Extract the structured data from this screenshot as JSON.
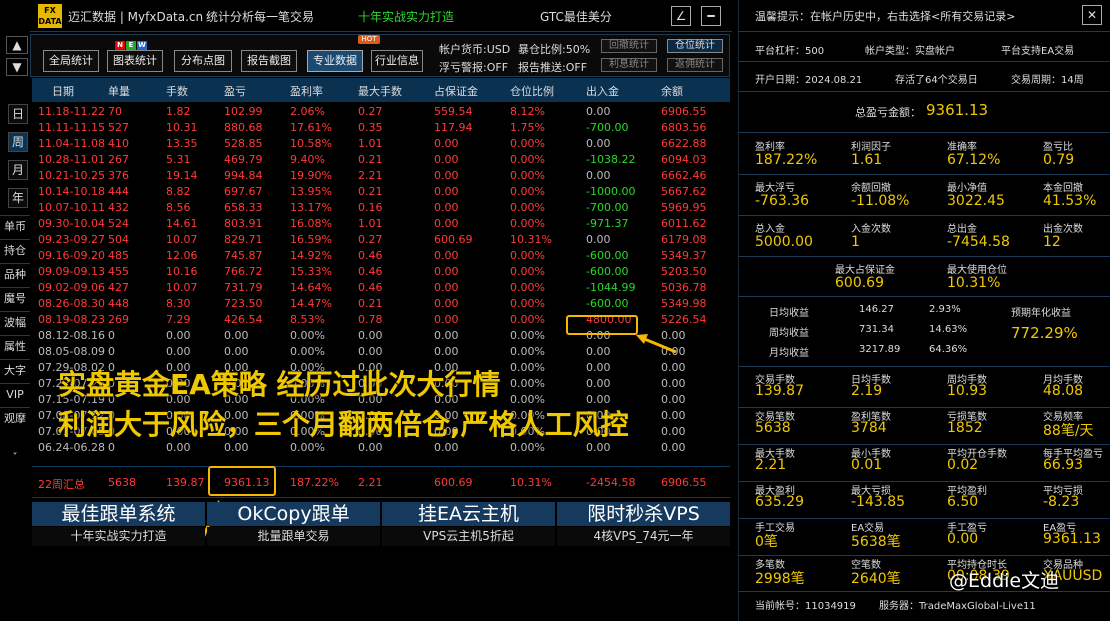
{
  "app": {
    "logo_text_top": "FX",
    "logo_text_bottom": "DATA",
    "title": "迈汇数据 | MyfxData.cn",
    "slogan": "统计分析每一笔交易",
    "tagline": "十年实战实力打造",
    "account_name": "GTC最佳美分"
  },
  "sidebar": {
    "up": "▲",
    "down": "▼",
    "periods": [
      "日",
      "周",
      "月",
      "年"
    ],
    "active_period": "周",
    "items": [
      "单币",
      "持仓",
      "品种",
      "魔号",
      "波幅",
      "属性",
      "大字",
      "VIP",
      "观摩"
    ],
    "collapse": "˅"
  },
  "toolbar": {
    "buttons": [
      "全局统计",
      "图表统计",
      "分布点图",
      "报告截图",
      "专业数据",
      "行业信息"
    ],
    "active_button": "专业数据",
    "hot_badge": "HOT",
    "new_badge": [
      "N",
      "E",
      "W"
    ],
    "currency": "帐户货币:USD",
    "blowup": "暴仓比例:50%",
    "float_alert": "浮亏警报:OFF",
    "report_push": "报告推送:OFF",
    "mini_buttons": [
      "回撤统计",
      "仓位统计",
      "利息统计",
      "返佣统计"
    ],
    "mini_active": "仓位统计"
  },
  "table": {
    "headers": [
      "日期",
      "单量",
      "手数",
      "盈亏",
      "盈利率",
      "最大手数",
      "占保证金",
      "仓位比例",
      "出入金",
      "余额"
    ],
    "rows": [
      [
        "11.18-11.22",
        "70",
        "1.82",
        "102.99",
        "2.06%",
        "0.27",
        "559.54",
        "8.12%",
        "0.00",
        "6906.55"
      ],
      [
        "11.11-11.15",
        "527",
        "10.31",
        "880.68",
        "17.61%",
        "0.35",
        "117.94",
        "1.75%",
        "-700.00",
        "6803.56"
      ],
      [
        "11.04-11.08",
        "410",
        "13.35",
        "528.85",
        "10.58%",
        "1.01",
        "0.00",
        "0.00%",
        "0.00",
        "6622.88"
      ],
      [
        "10.28-11.01",
        "267",
        "5.31",
        "469.79",
        "9.40%",
        "0.21",
        "0.00",
        "0.00%",
        "-1038.22",
        "6094.03"
      ],
      [
        "10.21-10.25",
        "376",
        "19.14",
        "994.84",
        "19.90%",
        "2.21",
        "0.00",
        "0.00%",
        "0.00",
        "6662.46"
      ],
      [
        "10.14-10.18",
        "444",
        "8.82",
        "697.67",
        "13.95%",
        "0.21",
        "0.00",
        "0.00%",
        "-1000.00",
        "5667.62"
      ],
      [
        "10.07-10.11",
        "432",
        "8.56",
        "658.33",
        "13.17%",
        "0.16",
        "0.00",
        "0.00%",
        "-700.00",
        "5969.95"
      ],
      [
        "09.30-10.04",
        "524",
        "14.61",
        "803.91",
        "16.08%",
        "1.01",
        "0.00",
        "0.00%",
        "-971.37",
        "6011.62"
      ],
      [
        "09.23-09.27",
        "504",
        "10.07",
        "829.71",
        "16.59%",
        "0.27",
        "600.69",
        "10.31%",
        "0.00",
        "6179.08"
      ],
      [
        "09.16-09.20",
        "485",
        "12.06",
        "745.87",
        "14.92%",
        "0.46",
        "0.00",
        "0.00%",
        "-600.00",
        "5349.37"
      ],
      [
        "09.09-09.13",
        "455",
        "10.16",
        "766.72",
        "15.33%",
        "0.46",
        "0.00",
        "0.00%",
        "-600.00",
        "5203.50"
      ],
      [
        "09.02-09.06",
        "427",
        "10.07",
        "731.79",
        "14.64%",
        "0.46",
        "0.00",
        "0.00%",
        "-1044.99",
        "5036.78"
      ],
      [
        "08.26-08.30",
        "448",
        "8.30",
        "723.50",
        "14.47%",
        "0.21",
        "0.00",
        "0.00%",
        "-600.00",
        "5349.98"
      ],
      [
        "08.19-08.23",
        "269",
        "7.29",
        "426.54",
        "8.53%",
        "0.78",
        "0.00",
        "0.00%",
        "4800.00",
        "5226.54"
      ],
      [
        "08.12-08.16",
        "0",
        "0.00",
        "0.00",
        "0.00%",
        "0.00",
        "0.00",
        "0.00%",
        "0.00",
        "0.00"
      ],
      [
        "08.05-08.09",
        "0",
        "0.00",
        "0.00",
        "0.00%",
        "0.00",
        "0.00",
        "0.00%",
        "0.00",
        "0.00"
      ],
      [
        "07.29-08.02",
        "0",
        "0.00",
        "0.00",
        "0.00%",
        "0.00",
        "0.00",
        "0.00%",
        "0.00",
        "0.00"
      ],
      [
        "07.22-07.26",
        "0",
        "0.00",
        "0.00",
        "0.00%",
        "0.00",
        "0.00",
        "0.00%",
        "0.00",
        "0.00"
      ],
      [
        "07.15-07.19",
        "0",
        "0.00",
        "0.00",
        "0.00%",
        "0.00",
        "0.00",
        "0.00%",
        "0.00",
        "0.00"
      ],
      [
        "07.08-07.12",
        "0",
        "0.00",
        "0.00",
        "0.00%",
        "0.00",
        "0.00",
        "0.00%",
        "0.00",
        "0.00"
      ],
      [
        "07.01-07.05",
        "0",
        "0.00",
        "0.00",
        "0.00%",
        "0.00",
        "0.00",
        "0.00%",
        "0.00",
        "0.00"
      ],
      [
        "06.24-06.28",
        "0",
        "0.00",
        "0.00",
        "0.00%",
        "0.00",
        "0.00",
        "0.00%",
        "0.00",
        "0.00"
      ]
    ],
    "summary": [
      "22周汇总",
      "5638",
      "139.87",
      "9361.13",
      "187.22%",
      "2.21",
      "600.69",
      "10.31%",
      "-2454.58",
      "6906.55"
    ]
  },
  "overlay_text": {
    "line1": "实盘黄金EA策略 经历过此次大行情",
    "line2": "利润大于风险，三个月翻两倍仓,严格人工风控"
  },
  "banners": [
    {
      "title": "最佳跟单系统",
      "sub": "十年实战实力打造"
    },
    {
      "title": "OkCopy跟单",
      "sub": "批量跟单交易"
    },
    {
      "title": "挂EA云主机",
      "sub": "VPS云主机5折起"
    },
    {
      "title": "限时秒杀VPS",
      "sub": "4核VPS_74元一年"
    }
  ],
  "right_panel": {
    "notice": "温馨提示：在帐户历史中，右击选择<所有交易记录>",
    "close": "✕",
    "leverage": "平台杠杆：500",
    "account_type": "帐户类型：实盘帐户",
    "ea_support": "平台支持EA交易",
    "open_date": "开户日期：2024.08.21",
    "days": "存活了64个交易日",
    "cycle": "交易周期：14周",
    "total_label": "总盈亏金额：",
    "total_value": "9361.13",
    "stats1": [
      {
        "l": "盈利率",
        "v": "187.22%"
      },
      {
        "l": "利润因子",
        "v": "1.61"
      },
      {
        "l": "准确率",
        "v": "67.12%"
      },
      {
        "l": "盈亏比",
        "v": "0.79"
      },
      {
        "l": "最大浮亏",
        "v": "-763.36"
      },
      {
        "l": "余额回撤",
        "v": "-11.08%"
      },
      {
        "l": "最小净值",
        "v": "3022.45"
      },
      {
        "l": "本金回撤",
        "v": "41.53%"
      },
      {
        "l": "总入金",
        "v": "5000.00"
      },
      {
        "l": "入金次数",
        "v": "1"
      },
      {
        "l": "总出金",
        "v": "-7454.58"
      },
      {
        "l": "出金次数",
        "v": "12"
      }
    ],
    "stats1b": [
      {
        "l": "最大占保证金",
        "v": "600.69"
      },
      {
        "l": "最大使用仓位",
        "v": "10.31%"
      }
    ],
    "avg": [
      {
        "l": "日均收益",
        "a": "146.27",
        "p": "2.93%"
      },
      {
        "l": "周均收益",
        "a": "731.34",
        "p": "14.63%"
      },
      {
        "l": "月均收益",
        "a": "3217.89",
        "p": "64.36%"
      }
    ],
    "annual_label": "预期年化收益",
    "annual_value": "772.29%",
    "stats2": [
      {
        "l": "交易手数",
        "v": "139.87"
      },
      {
        "l": "日均手数",
        "v": "2.19"
      },
      {
        "l": "周均手数",
        "v": "10.93"
      },
      {
        "l": "月均手数",
        "v": "48.08"
      },
      {
        "l": "交易笔数",
        "v": "5638"
      },
      {
        "l": "盈利笔数",
        "v": "3784"
      },
      {
        "l": "亏损笔数",
        "v": "1852"
      },
      {
        "l": "交易频率",
        "v": "88笔/天"
      },
      {
        "l": "最大手数",
        "v": "2.21"
      },
      {
        "l": "最小手数",
        "v": "0.01"
      },
      {
        "l": "平均开仓手数",
        "v": "0.02"
      },
      {
        "l": "每手平均盈亏",
        "v": "66.93"
      },
      {
        "l": "最大盈利",
        "v": "635.29"
      },
      {
        "l": "最大亏损",
        "v": "-143.85"
      },
      {
        "l": "平均盈利",
        "v": "6.50"
      },
      {
        "l": "平均亏损",
        "v": "-8.23"
      },
      {
        "l": "手工交易",
        "v": "0笔"
      },
      {
        "l": "EA交易",
        "v": "5638笔"
      },
      {
        "l": "手工盈亏",
        "v": "0.00"
      },
      {
        "l": "EA盈亏",
        "v": "9361.13"
      },
      {
        "l": "多笔数",
        "v": "2998笔"
      },
      {
        "l": "空笔数",
        "v": "2640笔"
      },
      {
        "l": "平均持仓时长",
        "v": "00:08:39"
      },
      {
        "l": "交易品种",
        "v": "XAUUSD"
      }
    ],
    "account_no": "当前帐号：11034919",
    "server": "服务器：TradeMaxGlobal-Live11",
    "watermark": "@Eddie文迪"
  }
}
